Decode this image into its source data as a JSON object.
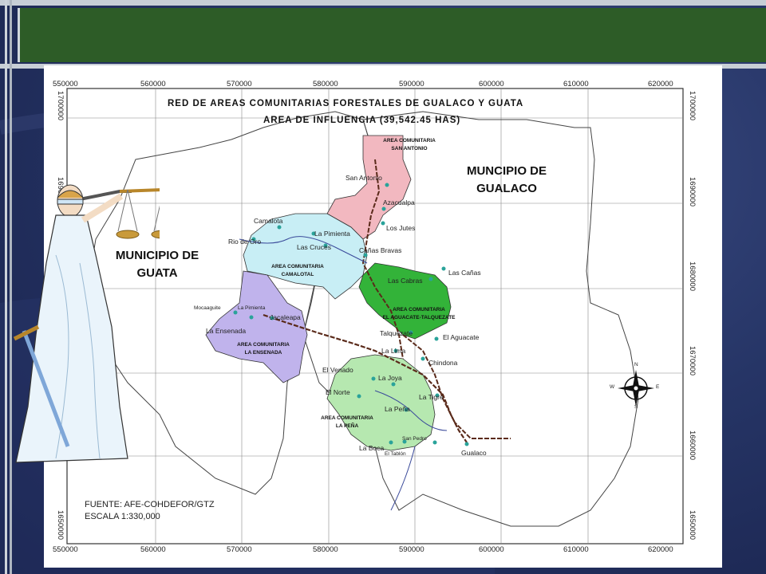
{
  "map": {
    "title_line1": "RED DE AREAS COMUNITARIAS FORESTALES DE GUALACO Y GUATA",
    "title_line2": "AREA DE INFLUENCIA (39,542.45 HAS)",
    "municipalities": {
      "gualaco": [
        "MUNCIPIO DE",
        "GUALACO"
      ],
      "guata": [
        "MUNICIPIO DE",
        "GUATA"
      ]
    },
    "grid": {
      "top_eastings": [
        "550000",
        "560000",
        "570000",
        "580000",
        "590000",
        "600000",
        "610000",
        "620000"
      ],
      "bottom_eastings": [
        "550000",
        "560000",
        "570000",
        "580000",
        "590000",
        "600000",
        "610000",
        "620000"
      ],
      "right_northings": [
        "1700000",
        "1690000",
        "1680000",
        "1670000",
        "1660000",
        "1650000"
      ],
      "left_northings": [
        "1700000",
        "1690000",
        "1680000",
        "1670000",
        "1660000",
        "1650000"
      ]
    },
    "community_areas": {
      "san_antonio": [
        "AREA COMUNITARIA",
        "SAN ANTONIO"
      ],
      "camalotal": [
        "AREA COMUNITARIA",
        "CAMALOTAL"
      ],
      "la_ensenada": [
        "AREA COMUNITARIA",
        "LA ENSENADA"
      ],
      "aguacate_talquezate": [
        "AREA COMUNITARIA",
        "EL AGUACATE-TALQUEZATE"
      ],
      "la_pena": [
        "AREA COMUNITARIA",
        "LA PEÑA"
      ]
    },
    "places": {
      "san_antonio": "San Antonio",
      "azacualpa": "Azacualpa",
      "los_jutes": "Los Jutes",
      "camalota": "Camalota",
      "rio_de_oro": "Rio de Oro",
      "la_pimienta": "La Pimienta",
      "las_cruces": "Las Cruces",
      "canas_bravas": "Cañas Bravas",
      "las_canas": "Las Cañas",
      "las_cabras": "Las Cabras",
      "mocaaguite": "Mocaaguite",
      "la_pimienta_small": "La Pimienta",
      "jacaleapa": "Jacaleapa",
      "la_ensenada": "La Ensenada",
      "talquezate": "Talquezate",
      "el_aguacate": "El Aguacate",
      "la_lima": "La Lima",
      "chindona": "Chindona",
      "el_venado": "El Venado",
      "la_joya": "La Joya",
      "el_norte": "El Norte",
      "la_tigre": "La Tigre",
      "la_pena": "La Peña",
      "san_pedro": "San Pedro",
      "la_boca": "La Boca",
      "el_tablon": "El Tablón",
      "gualaco": "Gualaco"
    },
    "compass_letters": {
      "n": "N",
      "s": "S",
      "e": "E",
      "w": "W"
    },
    "source_line1": "FUENTE: AFE-COHDEFOR/GTZ",
    "source_line2": "ESCALA 1:330,000"
  },
  "colors": {
    "slide_background": "#22305e",
    "top_band": "#2d5c27",
    "san_antonio_fill": "#f2b8c0",
    "camalotal_fill": "#c8eef5",
    "la_ensenada_fill": "#c0b3ec",
    "aguacate_fill": "#33b339",
    "la_pena_fill": "#b6e8b0"
  }
}
